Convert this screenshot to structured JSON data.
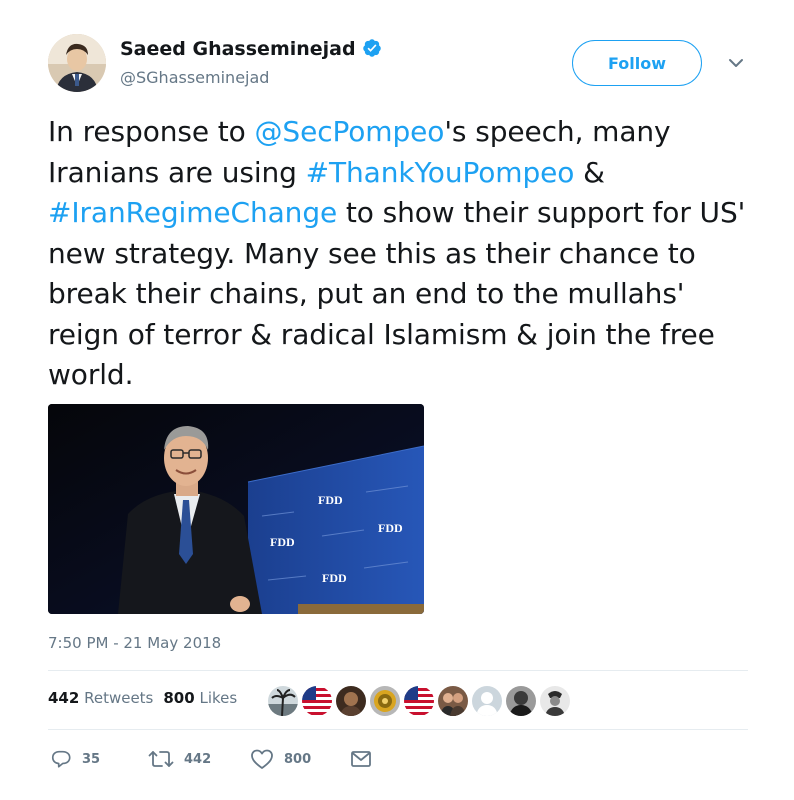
{
  "author": {
    "display_name": "Saeed Ghasseminejad",
    "handle": "@SGhasseminejad",
    "verified": true,
    "avatar_icon": "profile-photo"
  },
  "follow_button": {
    "label": "Follow"
  },
  "menu": {
    "icon": "chevron-down-icon"
  },
  "tweet": {
    "segments": [
      {
        "text": "In response to ",
        "link": false
      },
      {
        "text": "@SecPompeo",
        "link": true
      },
      {
        "text": "'s speech, many Iranians are using ",
        "link": false
      },
      {
        "text": "#ThankYouPompeo",
        "link": true
      },
      {
        "text": " & ",
        "link": false
      },
      {
        "text": "#IranRegimeChange",
        "link": true
      },
      {
        "text": " to show their support for US' new strategy. Many see this as their chance to break their chains, put an end to the mullahs' reign of terror & radical Islamism & join the free world.",
        "link": false
      }
    ]
  },
  "media": {
    "description_icon": "photo",
    "banner_text": [
      "FDD",
      "FDD",
      "FDD",
      "FDD"
    ]
  },
  "timestamp": "7:50 PM - 21 May 2018",
  "stats": {
    "retweets_count": "442",
    "retweets_label": "Retweets",
    "likes_count": "800",
    "likes_label": "Likes"
  },
  "likers": [
    {
      "icon": "avatar-palm"
    },
    {
      "icon": "avatar-us-flag"
    },
    {
      "icon": "avatar-person"
    },
    {
      "icon": "avatar-badge"
    },
    {
      "icon": "avatar-us-flag"
    },
    {
      "icon": "avatar-couple"
    },
    {
      "icon": "avatar-default"
    },
    {
      "icon": "avatar-bw-person"
    },
    {
      "icon": "avatar-bw-figure"
    }
  ],
  "actions": {
    "reply_count": "35",
    "retweet_count": "442",
    "like_count": "800"
  },
  "colors": {
    "link": "#1da1f2",
    "text": "#14171a",
    "muted": "#657786"
  }
}
